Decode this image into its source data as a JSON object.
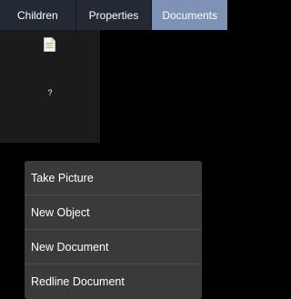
{
  "tabs": [
    {
      "label": "Children",
      "active": false
    },
    {
      "label": "Properties",
      "active": false
    },
    {
      "label": "Documents",
      "active": true
    }
  ],
  "documents": [
    {
      "icon": "document-icon",
      "name": "?"
    }
  ],
  "menu": {
    "items": [
      {
        "label": "Take Picture"
      },
      {
        "label": "New Object"
      },
      {
        "label": "New Document"
      },
      {
        "label": "Redline Document"
      }
    ]
  },
  "colors": {
    "tab_bar": "#232a33",
    "tab_active": "#7d92b4",
    "tile_bg": "#1b1b1b",
    "menu_bg": "#3a3a3a",
    "background": "#000000"
  }
}
